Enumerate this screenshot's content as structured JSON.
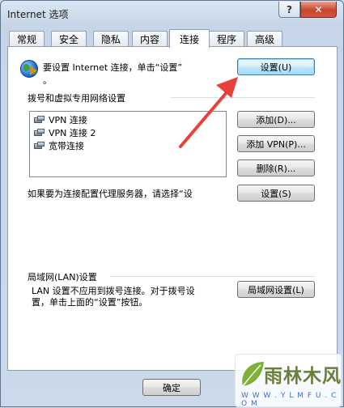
{
  "window": {
    "title": "Internet 选项",
    "help_label": "?",
    "close_label": "✕"
  },
  "tabs": [
    {
      "label": "常规"
    },
    {
      "label": "安全"
    },
    {
      "label": "隐私"
    },
    {
      "label": "内容"
    },
    {
      "label": "连接",
      "active": true
    },
    {
      "label": "程序"
    },
    {
      "label": "高级"
    }
  ],
  "setup": {
    "icon": "internet-globe-icon",
    "text": "要设置 Internet 连接，单击“设置”",
    "text_dot": "。",
    "button_label": "设置(U)"
  },
  "dialup": {
    "heading": "拨号和虚拟专用网络设置",
    "connections": [
      {
        "label": "VPN 连接",
        "icon": "network-connection-icon"
      },
      {
        "label": "VPN 连接 2",
        "icon": "network-connection-icon"
      },
      {
        "label": "宽带连接",
        "icon": "network-connection-icon"
      }
    ],
    "add_label": "添加(D)...",
    "add_vpn_label": "添加 VPN(P)...",
    "remove_label": "删除(R)...",
    "proxy_text": "如果要为连接配置代理服务器，请选择“设",
    "settings_label": "设置(S)"
  },
  "lan": {
    "heading": "局域网(LAN)设置",
    "desc_line1": "LAN 设置不应用到拨号连接。对于拨号设",
    "desc_line2": "置，单击上面的“设置”按钮。",
    "button_label": "局域网设置(L)"
  },
  "footer": {
    "ok_label": "确定"
  },
  "watermark": {
    "brand": "雨林木风",
    "url": "W W W . Y L M F U . C O M"
  },
  "colors": {
    "annotation_arrow": "#e8413a",
    "watermark_green": "#6a7f3c"
  }
}
